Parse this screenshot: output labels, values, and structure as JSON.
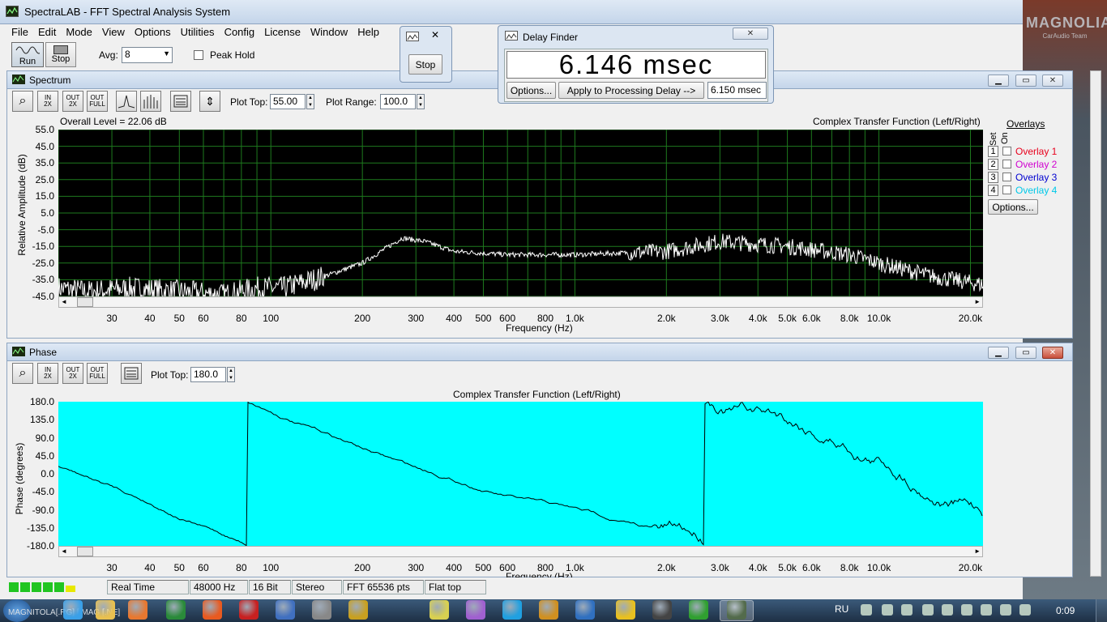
{
  "app": {
    "title": "SpectraLAB - FFT Spectral Analysis System",
    "menu": [
      "File",
      "Edit",
      "Mode",
      "View",
      "Options",
      "Utilities",
      "Config",
      "License",
      "Window",
      "Help"
    ],
    "run_label": "Run",
    "stop_label": "Stop",
    "avg_label": "Avg:",
    "avg_value": "8",
    "peak_hold_label": "Peak Hold",
    "watermark": "MAGNOLIA",
    "watermark_sub": "CarAudio Team"
  },
  "stop_dialog": {
    "button": "Stop"
  },
  "delay_finder": {
    "title": "Delay Finder",
    "value": "6.146 msec",
    "options_button": "Options...",
    "apply_button": "Apply to Processing Delay -->",
    "applied_value": "6.150 msec"
  },
  "spectrum": {
    "title": "Spectrum",
    "toolbar": [
      "⤢",
      "IN 2X",
      "OUT 2X",
      "OUT FULL"
    ],
    "plot_top_label": "Plot Top:",
    "plot_top_value": "55.00",
    "plot_range_label": "Plot Range:",
    "plot_range_value": "100.0",
    "overall_level": "Overall Level = 22.06 dB",
    "caption": "Complex Transfer Function (Left/Right)",
    "ylabel": "Relative Amplitude (dB)",
    "xlabel": "Frequency (Hz)",
    "yticks": [
      "55.0",
      "45.0",
      "35.0",
      "25.0",
      "15.0",
      "5.0",
      "-5.0",
      "-15.0",
      "-25.0",
      "-35.0",
      "-45.0"
    ],
    "overlays_title": "Overlays",
    "set_label": "Set",
    "on_label": "On",
    "overlays": [
      {
        "num": "1",
        "label": "Overlay 1",
        "color": "#e8001c"
      },
      {
        "num": "2",
        "label": "Overlay 2",
        "color": "#d000d0"
      },
      {
        "num": "3",
        "label": "Overlay 3",
        "color": "#0000d0"
      },
      {
        "num": "4",
        "label": "Overlay 4",
        "color": "#00c8e8"
      }
    ],
    "options_button": "Options..."
  },
  "phase": {
    "title": "Phase",
    "plot_top_label": "Plot Top:",
    "plot_top_value": "180.0",
    "caption": "Complex Transfer Function (Left/Right)",
    "ylabel": "Phase (degrees)",
    "xlabel": "Frequency (Hz)",
    "yticks": [
      "180.0",
      "135.0",
      "90.0",
      "45.0",
      "0.0",
      "-45.0",
      "-90.0",
      "-135.0",
      "-180.0"
    ]
  },
  "xticks": [
    "30",
    "40",
    "50",
    "60",
    "80",
    "100",
    "200",
    "300",
    "400",
    "500",
    "600",
    "800",
    "1.0k",
    "2.0k",
    "3.0k",
    "4.0k",
    "5.0k",
    "6.0k",
    "8.0k",
    "10.0k",
    "20.0k"
  ],
  "status": {
    "mode": "Real Time",
    "rate": "48000 Hz",
    "bits": "16 Bit",
    "channels": "Stereo",
    "fft": "FFT 65536 pts",
    "window": "Flat top"
  },
  "taskbar": {
    "tray_lang": "RU",
    "clock": "0:09",
    "ghost_text": "MAGNITOLA[.RG] [.MAG [.NE]"
  },
  "colors": {
    "spectrum_bg": "#000000",
    "spectrum_grid": "#1e7a1e",
    "phase_bg": "#00ffff",
    "trace": "#ffffff"
  }
}
